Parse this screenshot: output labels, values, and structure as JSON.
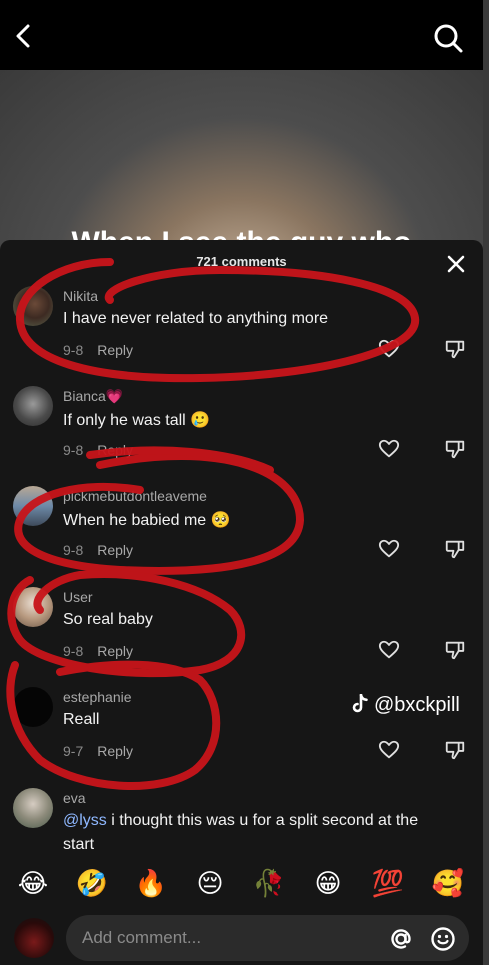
{
  "header": {
    "back_icon": "chevron-left-icon",
    "search_icon": "search-icon"
  },
  "video": {
    "caption": "When I see the guy who"
  },
  "sheet": {
    "count_label": "721 comments",
    "close_icon": "close-icon"
  },
  "comments": [
    {
      "username": "Nikita",
      "text": "I have never related to anything more",
      "date": "9-8",
      "reply": "Reply"
    },
    {
      "username": "Bianca💗",
      "text": "If only he was tall 🥲",
      "date": "9-8",
      "reply": "Reply"
    },
    {
      "username": "pickmebutdontleaveme",
      "text": "When he babied me 🥺",
      "date": "9-8",
      "reply": "Reply"
    },
    {
      "username": "User",
      "text": "So real baby",
      "date": "9-8",
      "reply": "Reply"
    },
    {
      "username": "estephanie",
      "text": "Reall",
      "date": "9-7",
      "reply": "Reply"
    },
    {
      "username": "eva",
      "mention": "@lyss",
      "text": " i thought this was u for a split second at the",
      "text2": "start"
    }
  ],
  "watermark": {
    "handle": "@bxckpill",
    "icon": "tiktok-icon"
  },
  "emoji_bar": [
    "😂",
    "🤣",
    "🔥",
    "😔",
    "🥀",
    "😁",
    "💯",
    "🥰"
  ],
  "input": {
    "placeholder": "Add comment...",
    "at_icon": "at-icon",
    "emoji_icon": "smiley-icon"
  },
  "colors": {
    "scribble": "#c8141a",
    "sheet_bg": "#161616",
    "mention": "#8fb8ff"
  }
}
